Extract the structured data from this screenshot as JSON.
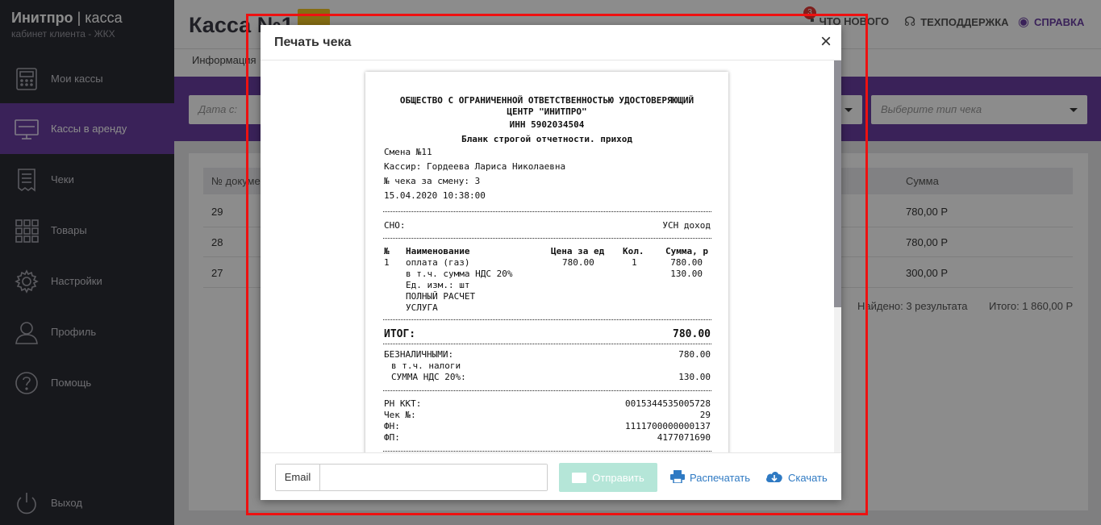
{
  "sidebar": {
    "brand_name": "Инитпро",
    "brand_sep": "|",
    "brand_product": "касса",
    "brand_sub": "кабинет клиента - ЖКХ",
    "items": [
      {
        "label": "Мои кассы",
        "icon": "cash-register-icon"
      },
      {
        "label": "Кассы в аренду",
        "icon": "monitor-www-icon"
      },
      {
        "label": "Чеки",
        "icon": "receipt-icon"
      },
      {
        "label": "Товары",
        "icon": "grid-icon"
      },
      {
        "label": "Настройки",
        "icon": "gear-icon"
      },
      {
        "label": "Профиль",
        "icon": "user-icon"
      },
      {
        "label": "Помощь",
        "icon": "help-icon"
      }
    ],
    "logout": "Выход"
  },
  "header": {
    "title": "Касса №1",
    "nav": {
      "whats_new": "ЧТО НОВОГО",
      "whats_new_badge": "3",
      "support": "ТЕХПОДДЕРЖКА",
      "help": "СПРАВКА"
    },
    "tab_info": "Информация"
  },
  "filters": {
    "date_from_placeholder": "Дата с:",
    "type_placeholder": "Выберите тип чека"
  },
  "table": {
    "headers": [
      "№ документа",
      "Сумма"
    ],
    "rows": [
      {
        "num": "29",
        "sum": "780,00 Р"
      },
      {
        "num": "28",
        "sum": "780,00 Р"
      },
      {
        "num": "27",
        "sum": "300,00 Р"
      }
    ],
    "found": "Найдено: 3 результата",
    "total": "Итого: 1 860,00 Р"
  },
  "modal": {
    "title": "Печать чека",
    "close": "×",
    "receipt": {
      "org_line1": "ОБЩЕСТВО С ОГРАНИЧЕННОЙ ОТВЕТСТВЕННОСТЬЮ УДОСТОВЕРЯЮЩИЙ",
      "org_line2": "ЦЕНТР \"ИНИТПРО\"",
      "inn": "ИНН 5902034504",
      "blank": "Бланк строгой отчетности. приход",
      "shift": "Смена №11",
      "cashier": "Кассир: Гордеева Лариса Николаевна",
      "check_in_shift": "№ чека за смену: 3",
      "datetime": "15.04.2020 10:38:00",
      "sno_label": "СНО:",
      "sno_value": "УСН доход",
      "col_num": "№",
      "col_name": "Наименование",
      "col_price": "Цена за ед",
      "col_qty": "Кол.",
      "col_sum": "Сумма, р",
      "item_num": "1",
      "item_name": "оплата (газ)",
      "item_price": "780.00",
      "item_qty": "1",
      "item_sum": "780.00",
      "item_vat_line": "в т.ч. сумма НДС 20%",
      "item_vat_value": "130.00",
      "item_unit": "Ед. изм.: шт",
      "item_calc": "ПОЛНЫЙ РАСЧЕТ",
      "item_kind": "УСЛУГА",
      "total_label": "ИТОГ:",
      "total_value": "780.00",
      "cashless_label": "БЕЗНАЛИЧНЫМИ:",
      "cashless_value": "780.00",
      "taxes_label": "в т.ч. налоги",
      "vat_label": "СУММА НДС 20%:",
      "vat_value": "130.00",
      "rn_label": "РН ККТ:",
      "rn_value": "0015344535005728",
      "check_label": "Чек №:",
      "check_value": "29",
      "fn_label": "ФН:",
      "fn_value": "1111700000000137",
      "fp_label": "ФП:",
      "fp_value": "4177071690"
    },
    "footer": {
      "email_label": "Email",
      "email_value": "",
      "send": "Отправить",
      "print": "Распечатать",
      "download": "Скачать"
    }
  },
  "colors": {
    "accent": "#6a3fa3",
    "sidebar": "#2b2c33",
    "send_disabled": "#b5e6d8",
    "link": "#2f7ac3",
    "frame": "#ee1111"
  }
}
